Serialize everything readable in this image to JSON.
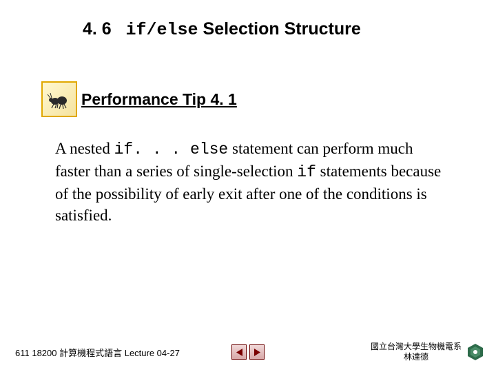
{
  "title": {
    "section": "4. 6",
    "code": "if/else",
    "rest": " Selection Structure"
  },
  "tip": {
    "label": "Performance Tip 4. 1"
  },
  "body": {
    "t1": "A nested ",
    "c1": "if. . . else",
    "t2": " statement can perform much faster than a series of single-selection ",
    "c2": "if",
    "t3": " statements because of the possibility of early exit after one of the conditions is satisfied."
  },
  "footer": {
    "left": "611 18200 計算機程式語言  Lecture 04-27",
    "affil_line1": "國立台灣大學生物機電系",
    "affil_line2": "林達德"
  }
}
